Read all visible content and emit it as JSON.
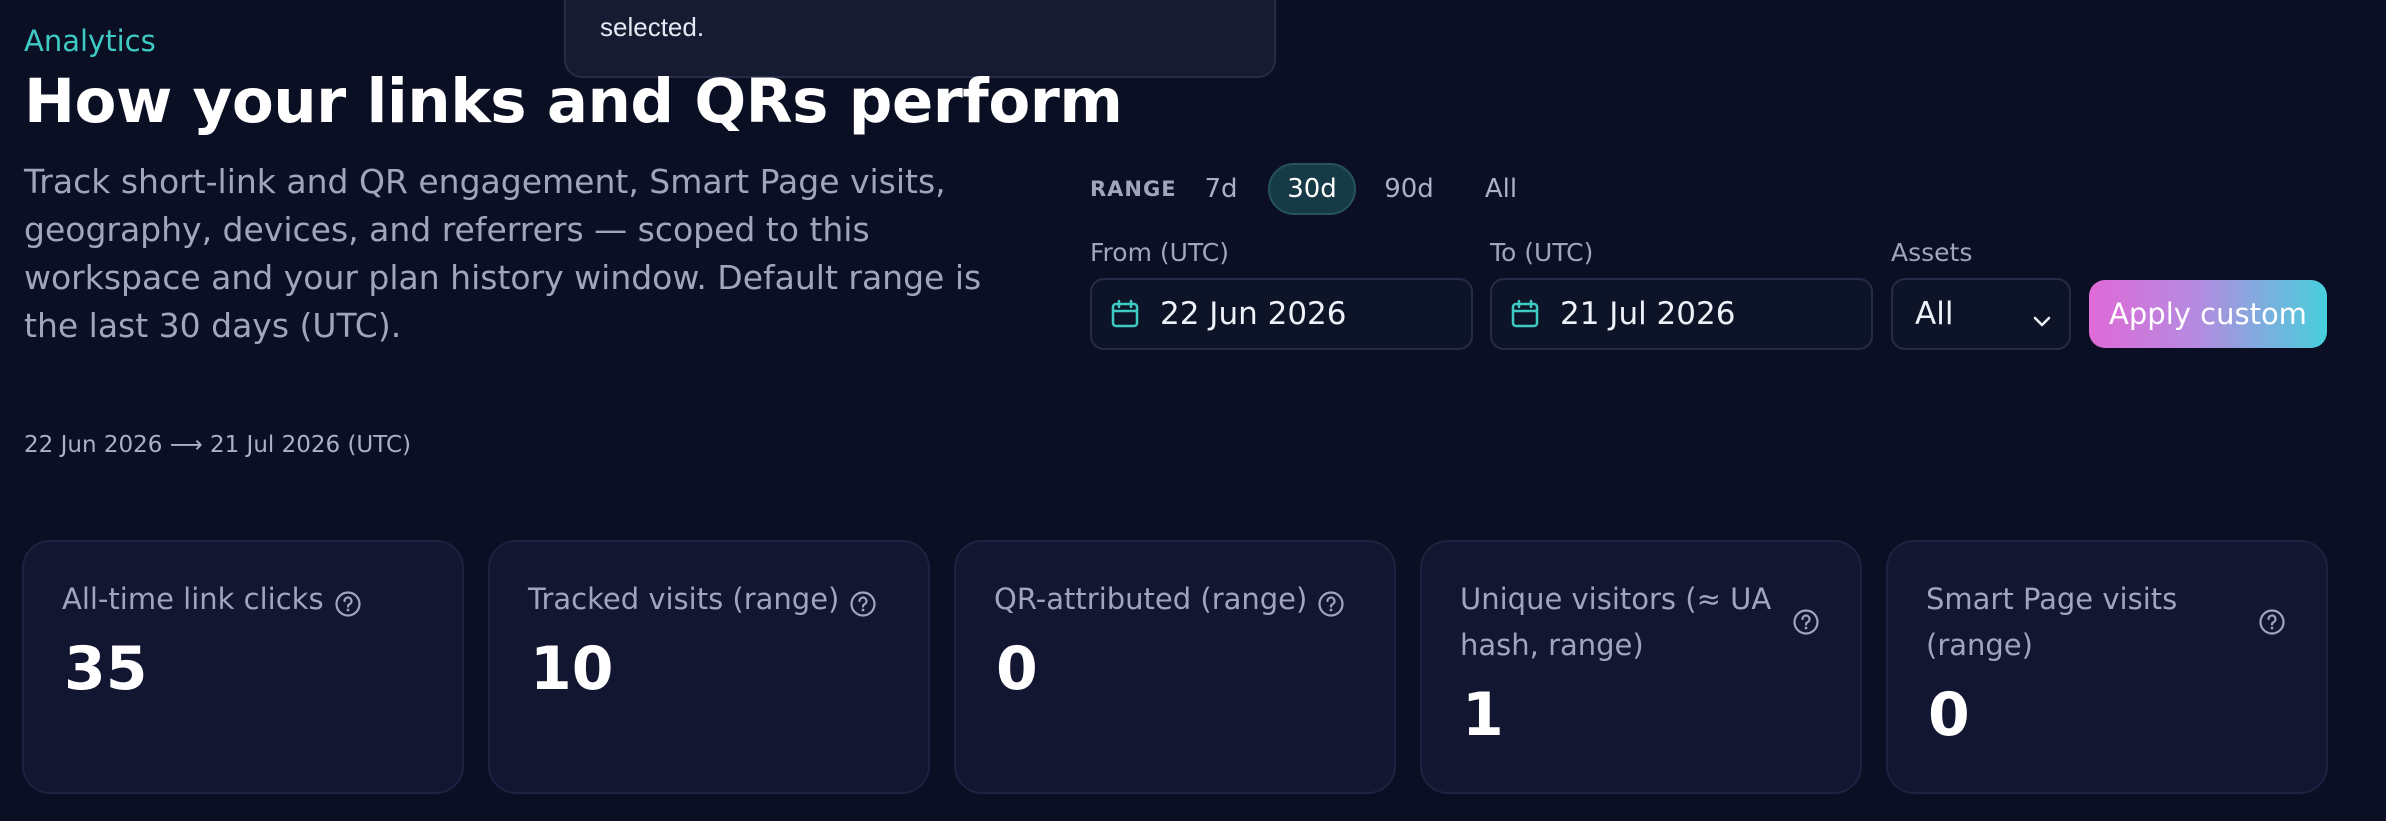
{
  "tooltip": {
    "text": "selected."
  },
  "header": {
    "eyebrow": "Analytics",
    "title": "How your links and QRs perform",
    "description": "Track short-link and QR engagement, Smart Page visits, geography, devices, and referrers — scoped to this workspace and your plan history window. Default range is the last 30 days (UTC)."
  },
  "range": {
    "label": "RANGE",
    "options": [
      "7d",
      "30d",
      "90d",
      "All"
    ],
    "selected": "30d"
  },
  "filters": {
    "from_label": "From (UTC)",
    "from_value": "22 Jun 2026",
    "to_label": "To (UTC)",
    "to_value": "21 Jul 2026",
    "assets_label": "Assets",
    "assets_value": "All",
    "apply_label": "Apply custom"
  },
  "summary": "22 Jun 2026 ⟶ 21 Jul 2026 (UTC)",
  "cards": [
    {
      "label": "All-time link clicks",
      "value": "35"
    },
    {
      "label": "Tracked visits (range)",
      "value": "10"
    },
    {
      "label": "QR-attributed (range)",
      "value": "0"
    },
    {
      "label": "Unique visitors (≈ UA hash, range)",
      "value": "1"
    },
    {
      "label": "Smart Page visits (range)",
      "value": "0"
    }
  ],
  "colors": {
    "background": "#0a0f24",
    "accent": "#3ecbc4",
    "card": "#121630",
    "gradient_start": "#e06ad8",
    "gradient_end": "#47cfdc"
  },
  "icons": [
    "calendar-icon",
    "chevron-down-icon",
    "help-circle-icon"
  ]
}
